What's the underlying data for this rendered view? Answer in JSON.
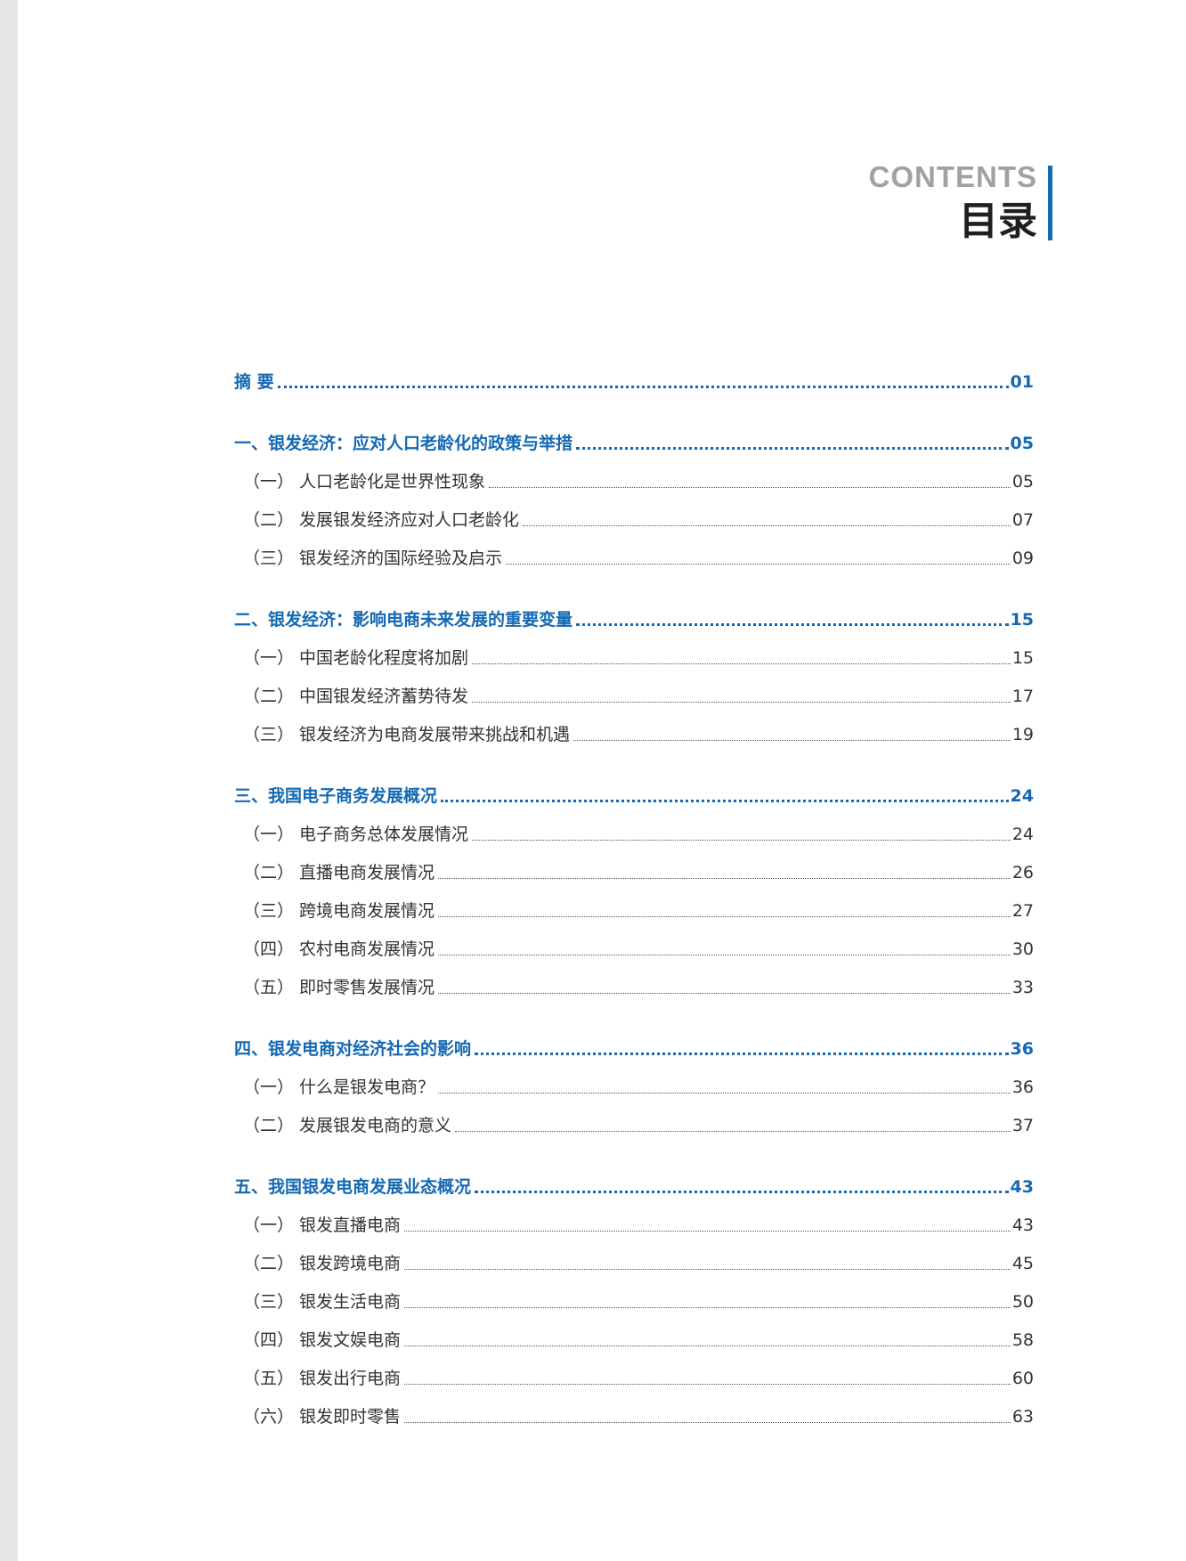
{
  "header": {
    "title_en": "CONTENTS",
    "title_cn": "目录"
  },
  "toc": {
    "abstract": {
      "label": "摘 要",
      "page": "01"
    },
    "ch1": {
      "label": "一、银发经济：应对人口老龄化的政策与举措",
      "page": "05",
      "items": [
        {
          "num": "（一）",
          "label": "人口老龄化是世界性现象",
          "page": "05"
        },
        {
          "num": "（二）",
          "label": "发展银发经济应对人口老龄化",
          "page": "07"
        },
        {
          "num": "（三）",
          "label": "银发经济的国际经验及启示",
          "page": "09"
        }
      ]
    },
    "ch2": {
      "label": "二、银发经济：影响电商未来发展的重要变量",
      "page": "15",
      "items": [
        {
          "num": "（一）",
          "label": "中国老龄化程度将加剧",
          "page": "15"
        },
        {
          "num": "（二）",
          "label": "中国银发经济蓄势待发",
          "page": "17"
        },
        {
          "num": "（三）",
          "label": "银发经济为电商发展带来挑战和机遇",
          "page": "19"
        }
      ]
    },
    "ch3": {
      "label": "三、我国电子商务发展概况",
      "page": "24",
      "items": [
        {
          "num": "（一）",
          "label": "电子商务总体发展情况",
          "page": "24"
        },
        {
          "num": "（二）",
          "label": "直播电商发展情况",
          "page": "26"
        },
        {
          "num": "（三）",
          "label": "跨境电商发展情况",
          "page": "27"
        },
        {
          "num": "（四）",
          "label": "农村电商发展情况",
          "page": "30"
        },
        {
          "num": "（五）",
          "label": "即时零售发展情况",
          "page": "33"
        }
      ]
    },
    "ch4": {
      "label": "四、银发电商对经济社会的影响",
      "page": "36",
      "items": [
        {
          "num": "（一）",
          "label": "什么是银发电商？",
          "page": "36"
        },
        {
          "num": "（二）",
          "label": "发展银发电商的意义",
          "page": "37"
        }
      ]
    },
    "ch5": {
      "label": "五、我国银发电商发展业态概况",
      "page": "43",
      "items": [
        {
          "num": "（一）",
          "label": "银发直播电商",
          "page": "43"
        },
        {
          "num": "（二）",
          "label": "银发跨境电商",
          "page": "45"
        },
        {
          "num": "（三）",
          "label": "银发生活电商",
          "page": "50"
        },
        {
          "num": "（四）",
          "label": "银发文娱电商",
          "page": "58"
        },
        {
          "num": "（五）",
          "label": "银发出行电商",
          "page": "60"
        },
        {
          "num": "（六）",
          "label": "银发即时零售",
          "page": "63"
        }
      ]
    }
  },
  "colors": {
    "accent": "#1469b2",
    "heading_gray": "#9fa1a4",
    "text": "#333333"
  }
}
